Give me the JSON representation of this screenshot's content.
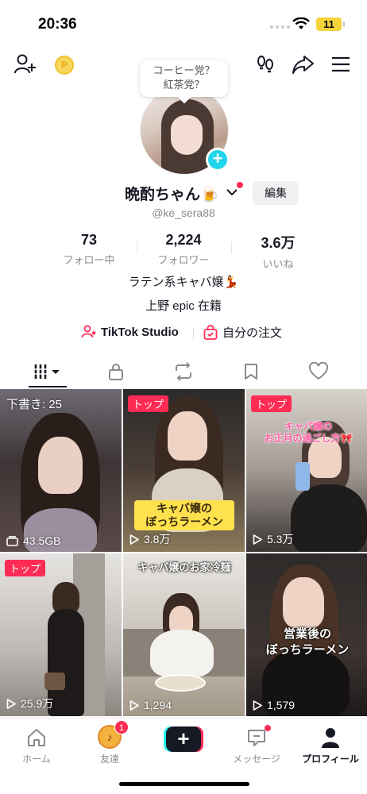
{
  "status_bar": {
    "time": "20:36",
    "battery": "11"
  },
  "top_nav": {
    "coin_symbol": "P"
  },
  "profile": {
    "bubble_note": "コーヒー党？\n紅茶党？",
    "display_name": "晩酌ちゃん🍺",
    "edit_label": "編集",
    "username": "@ke_sera88",
    "stats": [
      {
        "value": "73",
        "label": "フォロー中"
      },
      {
        "value": "2,224",
        "label": "フォロワー"
      },
      {
        "value": "3.6万",
        "label": "いいね"
      }
    ],
    "bio_line1": "ラテン系キャバ嬢💃",
    "bio_line2": "上野 epic 在籍",
    "link_studio": "TikTok Studio",
    "link_orders": "自分の注文"
  },
  "tabs": [
    "videos",
    "private",
    "reposts",
    "favorites",
    "liked"
  ],
  "videos": [
    {
      "badge": "",
      "draft": "下書き: 25",
      "stat": "43.5GB",
      "stat_icon": "storage-icon",
      "caption": ""
    },
    {
      "badge": "トップ",
      "draft": "",
      "stat": "3.8万",
      "stat_icon": "play-icon",
      "caption": "キャバ嬢の\nぼっちラーメン"
    },
    {
      "badge": "トップ",
      "draft": "",
      "stat": "5.3万",
      "stat_icon": "play-icon",
      "caption": "キャバ嬢の\nお正月の過ごし方🎀"
    },
    {
      "badge": "トップ",
      "draft": "",
      "stat": "25.9万",
      "stat_icon": "play-icon",
      "caption": ""
    },
    {
      "badge": "",
      "draft": "",
      "stat": "1,294",
      "stat_icon": "play-icon",
      "caption": "キャバ嬢のお家冷麺"
    },
    {
      "badge": "",
      "draft": "",
      "stat": "1,579",
      "stat_icon": "play-icon",
      "caption": "営業後の\nぼっちラーメン"
    }
  ],
  "bottom_nav": {
    "home": "ホーム",
    "friends": "友達",
    "friends_badge": "1",
    "create": "+",
    "inbox": "メッセージ",
    "profile": "プロフィール"
  },
  "colors": {
    "accent": "#fe2c55",
    "cyan": "#20d5ec",
    "text": "#161823",
    "muted": "#8a8b91"
  }
}
